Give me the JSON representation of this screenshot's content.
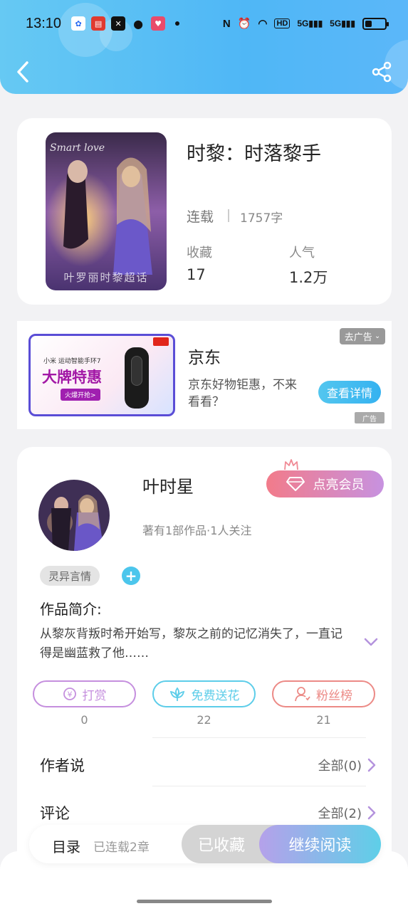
{
  "status_bar": {
    "time": "13:10",
    "app_icons": [
      "baidu-icon",
      "news-icon",
      "capcut-icon",
      "wechat-icon",
      "app-icon"
    ],
    "battery_level": 0.35,
    "signal_label_1": "5G",
    "signal_label_2": "5G",
    "hd_label": "HD"
  },
  "header": {
    "back_icon": "chevron-left-icon",
    "share_icon": "share-icon"
  },
  "book": {
    "title": "时黎：时落黎手",
    "status": "连载",
    "word_count": "1757字",
    "cover_caption": "叶罗丽时黎超话",
    "stats": [
      {
        "label": "收藏",
        "value": "17"
      },
      {
        "label": "人气",
        "value": "1.2万"
      }
    ]
  },
  "ad": {
    "banner_sub": "小米 运动智能手环7",
    "banner_big": "大牌特惠",
    "banner_btn": "火爆开抢>",
    "title": "京东",
    "description": "京东好物钜惠，不来看看？",
    "detail_button": "查看详情",
    "close_button": "去广告",
    "ad_mark": "广告"
  },
  "author": {
    "name": "叶时星",
    "meta": "著有1部作品·1人关注",
    "vip_button": "点亮会员",
    "tag": "灵异言情",
    "intro_label": "作品简介:",
    "intro_text": "从黎灰背叛时希开始写，黎灰之前的记忆消失了，一直记得是幽蓝救了他……",
    "actions": [
      {
        "label": "打赏",
        "count": "0",
        "icon": "yuan-coin-icon",
        "color": "#c58fde"
      },
      {
        "label": "免费送花",
        "count": "22",
        "icon": "flower-icon",
        "color": "#5dcde9"
      },
      {
        "label": "粉丝榜",
        "count": "21",
        "icon": "fan-user-icon",
        "color": "#ec8a86"
      }
    ],
    "rows": [
      {
        "title": "作者说",
        "right": "全部(0)"
      },
      {
        "title": "评论",
        "right": "全部(2)"
      }
    ]
  },
  "bottom_bar": {
    "toc": "目录",
    "toc_sub": "已连载2章",
    "fav_button": "已收藏",
    "read_button": "继续阅读"
  },
  "colors": {
    "header_blue": "#4fb7f6",
    "accent_purple": "#c58fde",
    "accent_cyan": "#5dcde9"
  }
}
